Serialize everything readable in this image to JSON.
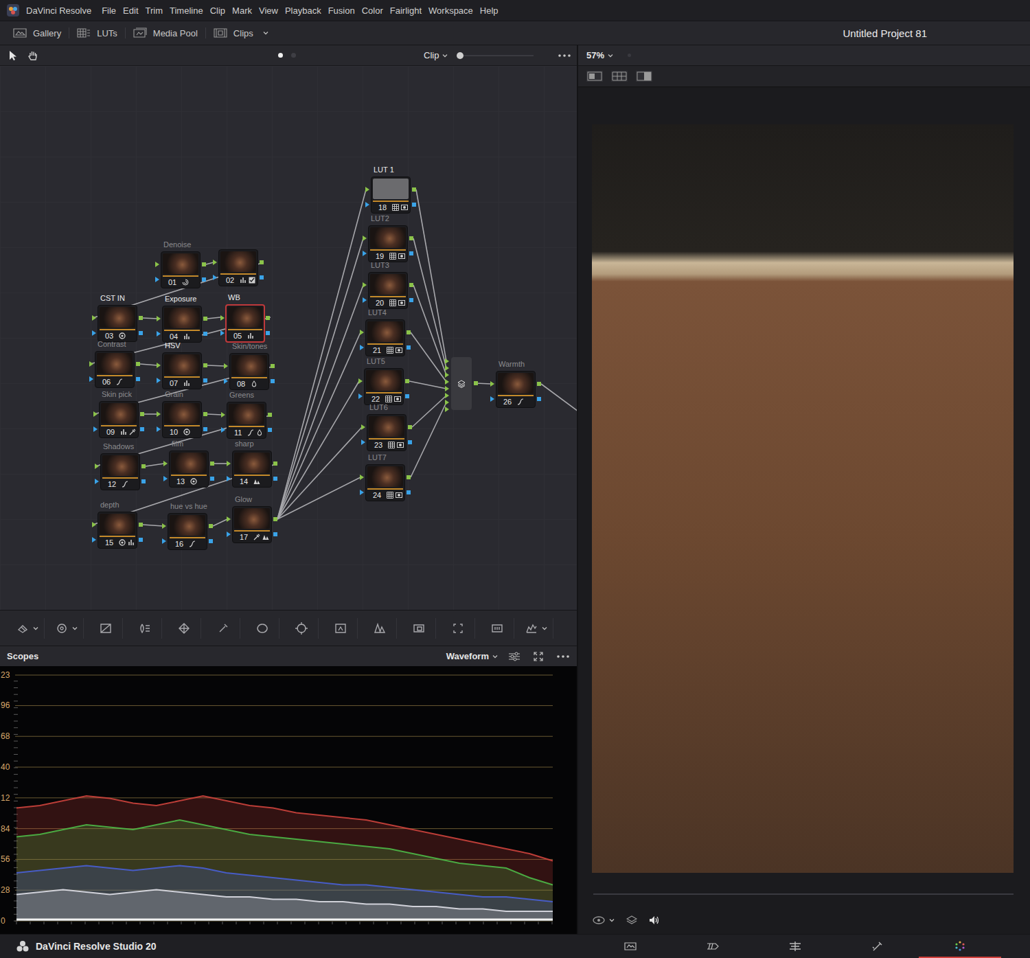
{
  "app": {
    "name": "DaVinci Resolve"
  },
  "menu": [
    "File",
    "Edit",
    "Trim",
    "Timeline",
    "Clip",
    "Mark",
    "View",
    "Playback",
    "Fusion",
    "Color",
    "Fairlight",
    "Workspace",
    "Help"
  ],
  "toolbar": [
    {
      "label": "Gallery",
      "kind": "gallery",
      "dropdown": false
    },
    {
      "label": "LUTs",
      "kind": "luts",
      "dropdown": false
    },
    {
      "label": "Media Pool",
      "kind": "mediapool",
      "dropdown": false
    },
    {
      "label": "Clips",
      "kind": "clips",
      "dropdown": true
    }
  ],
  "project_title": "Untitled Project 81",
  "node_editor": {
    "mode": "Clip",
    "pages": [
      {
        "selected": true
      },
      {
        "selected": false
      }
    ],
    "zoom_level": 0.0
  },
  "nodes": [
    {
      "number": "01",
      "label": "Denoise",
      "label_dim": true,
      "selected": false,
      "greyed": false,
      "tools": [
        "denoise"
      ],
      "to": [
        "02"
      ],
      "continues_right": false
    },
    {
      "number": "02",
      "label": "",
      "label_dim": true,
      "selected": false,
      "greyed": false,
      "tools": [
        "bars",
        "check"
      ],
      "to": [
        "03"
      ],
      "continues_right": false
    },
    {
      "number": "03",
      "label": "CST IN",
      "label_dim": false,
      "selected": false,
      "greyed": false,
      "tools": [
        "fx"
      ],
      "to": [
        "04"
      ],
      "continues_right": false
    },
    {
      "number": "04",
      "label": "Exposure",
      "label_dim": false,
      "selected": false,
      "greyed": false,
      "tools": [
        "bars"
      ],
      "to": [
        "05"
      ],
      "continues_right": false
    },
    {
      "number": "05",
      "label": "WB",
      "label_dim": false,
      "selected": true,
      "greyed": false,
      "tools": [
        "bars"
      ],
      "to": [
        "06"
      ],
      "continues_right": false
    },
    {
      "number": "06",
      "label": "Contrast",
      "label_dim": true,
      "selected": false,
      "greyed": false,
      "tools": [
        "curve"
      ],
      "to": [
        "07"
      ],
      "continues_right": false
    },
    {
      "number": "07",
      "label": "HSV",
      "label_dim": false,
      "selected": false,
      "greyed": false,
      "tools": [
        "bars"
      ],
      "to": [
        "08"
      ],
      "continues_right": false
    },
    {
      "number": "08",
      "label": "Skin/tones",
      "label_dim": true,
      "selected": false,
      "greyed": false,
      "tools": [
        "hsl"
      ],
      "to": [
        "09"
      ],
      "continues_right": false
    },
    {
      "number": "09",
      "label": "Skin pick",
      "label_dim": true,
      "selected": false,
      "greyed": false,
      "tools": [
        "bars",
        "picker"
      ],
      "to": [
        "10"
      ],
      "continues_right": false
    },
    {
      "number": "10",
      "label": "Grain",
      "label_dim": true,
      "selected": false,
      "greyed": false,
      "tools": [
        "fx"
      ],
      "to": [
        "11"
      ],
      "continues_right": false
    },
    {
      "number": "11",
      "label": "Greens",
      "label_dim": true,
      "selected": false,
      "greyed": false,
      "tools": [
        "curve",
        "hsl"
      ],
      "to": [
        "12"
      ],
      "continues_right": false
    },
    {
      "number": "12",
      "label": "Shadows",
      "label_dim": true,
      "selected": false,
      "greyed": false,
      "tools": [
        "curve"
      ],
      "to": [
        "13"
      ],
      "continues_right": false
    },
    {
      "number": "13",
      "label": "film",
      "label_dim": true,
      "selected": false,
      "greyed": false,
      "tools": [
        "fx"
      ],
      "to": [
        "14"
      ],
      "continues_right": false
    },
    {
      "number": "14",
      "label": "sharp",
      "label_dim": true,
      "selected": false,
      "greyed": false,
      "tools": [
        "blur"
      ],
      "to": [
        "15"
      ],
      "continues_right": false
    },
    {
      "number": "15",
      "label": "depth",
      "label_dim": true,
      "selected": false,
      "greyed": false,
      "tools": [
        "fx",
        "bars"
      ],
      "to": [
        "16"
      ],
      "continues_right": false
    },
    {
      "number": "16",
      "label": "hue vs hue",
      "label_dim": true,
      "selected": false,
      "greyed": false,
      "tools": [
        "curve"
      ],
      "to": [
        "17"
      ],
      "continues_right": false
    },
    {
      "number": "17",
      "label": "Glow",
      "label_dim": true,
      "selected": false,
      "greyed": false,
      "tools": [
        "picker",
        "blur"
      ],
      "to": [
        "18",
        "19",
        "20",
        "21",
        "22",
        "23",
        "24"
      ],
      "continues_right": false
    },
    {
      "number": "18",
      "label": "LUT 1",
      "label_dim": false,
      "selected": false,
      "greyed": true,
      "tools": [
        "lut",
        "fxbox"
      ],
      "to": [],
      "continues_right": false
    },
    {
      "number": "19",
      "label": "LUT2",
      "label_dim": true,
      "selected": false,
      "greyed": false,
      "tools": [
        "lut",
        "fxbox"
      ],
      "to": [],
      "continues_right": false
    },
    {
      "number": "20",
      "label": "LUT3",
      "label_dim": true,
      "selected": false,
      "greyed": false,
      "tools": [
        "lut",
        "fxbox"
      ],
      "to": [],
      "continues_right": false
    },
    {
      "number": "21",
      "label": "LUT4",
      "label_dim": true,
      "selected": false,
      "greyed": false,
      "tools": [
        "lut",
        "fxbox"
      ],
      "to": [],
      "continues_right": false
    },
    {
      "number": "22",
      "label": "LUT5",
      "label_dim": true,
      "selected": false,
      "greyed": false,
      "tools": [
        "lut",
        "fxbox"
      ],
      "to": [],
      "continues_right": false
    },
    {
      "number": "23",
      "label": "LUT6",
      "label_dim": true,
      "selected": false,
      "greyed": false,
      "tools": [
        "lut",
        "fxbox"
      ],
      "to": [],
      "continues_right": false
    },
    {
      "number": "24",
      "label": "LUT7",
      "label_dim": true,
      "selected": false,
      "greyed": false,
      "tools": [
        "lut",
        "fxbox"
      ],
      "to": [],
      "continues_right": false
    },
    {
      "number": "26",
      "label": "Warmth",
      "label_dim": true,
      "selected": false,
      "greyed": false,
      "tools": [
        "curve"
      ],
      "to": [],
      "continues_right": true
    }
  ],
  "mixer": {
    "inputs": [
      "18",
      "19",
      "20",
      "21",
      "22",
      "23",
      "24"
    ],
    "to": [
      "26"
    ]
  },
  "scopes": {
    "title": "Scopes",
    "type": "Waveform",
    "ticks": [
      {
        "label": "23",
        "value": 1023
      },
      {
        "label": "96",
        "value": 896
      },
      {
        "label": "68",
        "value": 768
      },
      {
        "label": "40",
        "value": 640
      },
      {
        "label": "12",
        "value": 512
      },
      {
        "label": "84",
        "value": 384
      },
      {
        "label": "56",
        "value": 256
      },
      {
        "label": "28",
        "value": 128
      },
      {
        "label": "0",
        "value": 0
      }
    ],
    "series": [
      {
        "color": "#d8463f",
        "values": [
          470,
          480,
          500,
          520,
          510,
          490,
          480,
          500,
          520,
          500,
          480,
          470,
          450,
          440,
          430,
          420,
          400,
          380,
          360,
          340,
          320,
          300,
          280,
          250
        ]
      },
      {
        "color": "#4fc24a",
        "values": [
          350,
          360,
          380,
          400,
          390,
          380,
          400,
          420,
          400,
          380,
          360,
          350,
          340,
          330,
          320,
          310,
          300,
          280,
          260,
          240,
          230,
          220,
          180,
          150
        ]
      },
      {
        "color": "#4a62e0",
        "values": [
          200,
          210,
          220,
          230,
          220,
          210,
          220,
          230,
          220,
          200,
          190,
          180,
          170,
          160,
          150,
          150,
          140,
          130,
          120,
          110,
          100,
          100,
          90,
          80
        ]
      },
      {
        "color": "#e8e8f0",
        "values": [
          110,
          120,
          130,
          120,
          110,
          120,
          130,
          120,
          110,
          100,
          100,
          90,
          90,
          80,
          80,
          70,
          70,
          60,
          60,
          50,
          50,
          40,
          40,
          40
        ]
      }
    ]
  },
  "viewer": {
    "zoom": "57%"
  },
  "status_bar": {
    "product": "DaVinci Resolve Studio 20",
    "pages": [
      {
        "kind": "media",
        "selected": false
      },
      {
        "kind": "cut",
        "selected": false
      },
      {
        "kind": "edit",
        "selected": false
      },
      {
        "kind": "fusion",
        "selected": false
      },
      {
        "kind": "color",
        "selected": true
      }
    ]
  }
}
